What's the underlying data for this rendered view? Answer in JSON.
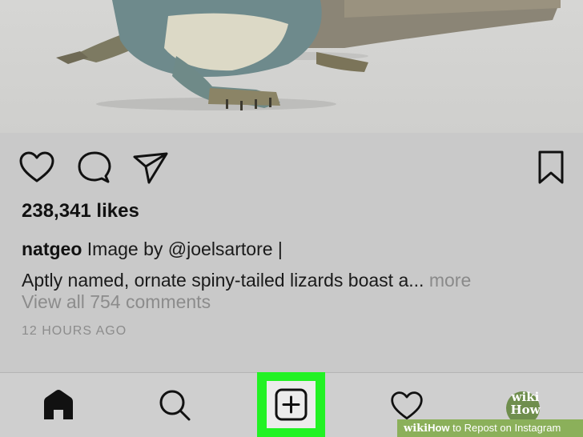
{
  "post": {
    "likes": "238,341 likes",
    "username": "natgeo",
    "caption_prefix": "Image by ",
    "mention": "@joelsartore",
    "caption_suffix": " |",
    "caption_line2": "Aptly named, ornate spiny-tailed lizards boast a...",
    "more_label": " more",
    "comments_link": "View all 754 comments",
    "timestamp": "12 HOURS AGO"
  },
  "action_icons": [
    "heart-icon",
    "comment-icon",
    "send-icon",
    "bookmark-icon"
  ],
  "tab_bar": {
    "icons": [
      "home-icon",
      "search-icon",
      "plus-square-icon",
      "heart-icon",
      "avatar"
    ],
    "highlight_color": "#22f224",
    "profile_logo_line1": "wiki",
    "profile_logo_line2": "How"
  },
  "watermark": {
    "brand_wiki": "wiki",
    "brand_how": "How",
    "title": " to Repost on Instagram"
  }
}
